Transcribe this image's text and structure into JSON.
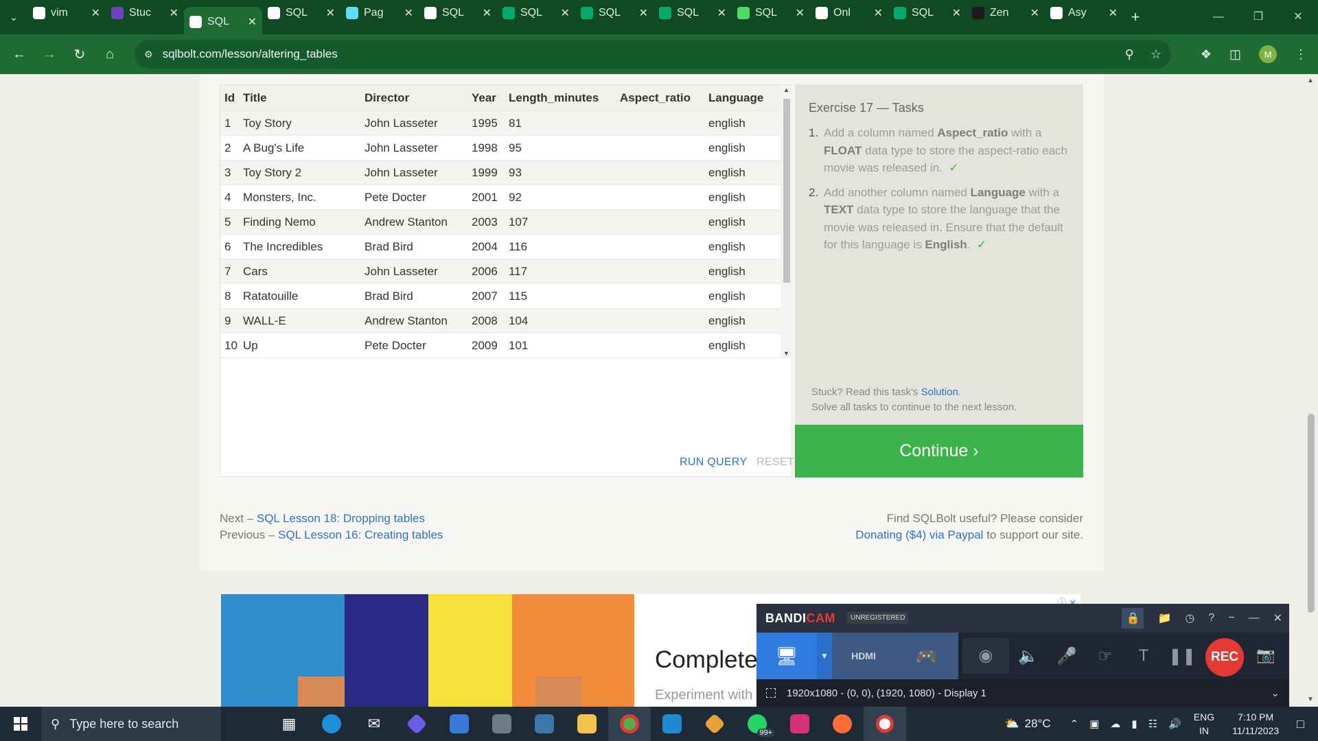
{
  "browser": {
    "tabs": [
      {
        "label": "vim",
        "fav": "github-icon",
        "color": "#ffffff"
      },
      {
        "label": "Stuc",
        "fav": "study-icon",
        "color": "#6f42c1"
      },
      {
        "label": "SQL",
        "fav": "database-icon",
        "color": "#ffffff",
        "active": true
      },
      {
        "label": "SQL",
        "fav": "database-icon",
        "color": "#ffffff"
      },
      {
        "label": "Pag",
        "fav": "react-icon",
        "color": "#61dafb"
      },
      {
        "label": "SQL",
        "fav": "leaf-icon",
        "color": "#ffffff"
      },
      {
        "label": "SQL",
        "fav": "w3-icon",
        "color": "#04aa6d"
      },
      {
        "label": "SQL",
        "fav": "w3-icon",
        "color": "#04aa6d"
      },
      {
        "label": "SQL",
        "fav": "w3-icon",
        "color": "#04aa6d"
      },
      {
        "label": "SQL",
        "fav": "spinner-icon",
        "color": "#4cd964"
      },
      {
        "label": "Onl",
        "fav": "leaf-icon",
        "color": "#ffffff"
      },
      {
        "label": "SQL",
        "fav": "w3-icon",
        "color": "#04aa6d"
      },
      {
        "label": "Zen",
        "fav": "zen-icon",
        "color": "#1b1b1b"
      },
      {
        "label": "Asy",
        "fav": "medium-icon",
        "color": "#ffffff"
      }
    ],
    "url": "sqlbolt.com/lesson/altering_tables",
    "profile_initial": "M",
    "theme_color": "#1e6b34"
  },
  "table": {
    "columns": [
      "Id",
      "Title",
      "Director",
      "Year",
      "Length_minutes",
      "Aspect_ratio",
      "Language"
    ],
    "rows": [
      [
        "1",
        "Toy Story",
        "John Lasseter",
        "1995",
        "81",
        "",
        "english"
      ],
      [
        "2",
        "A Bug's Life",
        "John Lasseter",
        "1998",
        "95",
        "",
        "english"
      ],
      [
        "3",
        "Toy Story 2",
        "John Lasseter",
        "1999",
        "93",
        "",
        "english"
      ],
      [
        "4",
        "Monsters, Inc.",
        "Pete Docter",
        "2001",
        "92",
        "",
        "english"
      ],
      [
        "5",
        "Finding Nemo",
        "Andrew Stanton",
        "2003",
        "107",
        "",
        "english"
      ],
      [
        "6",
        "The Incredibles",
        "Brad Bird",
        "2004",
        "116",
        "",
        "english"
      ],
      [
        "7",
        "Cars",
        "John Lasseter",
        "2006",
        "117",
        "",
        "english"
      ],
      [
        "8",
        "Ratatouille",
        "Brad Bird",
        "2007",
        "115",
        "",
        "english"
      ],
      [
        "9",
        "WALL-E",
        "Andrew Stanton",
        "2008",
        "104",
        "",
        "english"
      ],
      [
        "10",
        "Up",
        "Pete Docter",
        "2009",
        "101",
        "",
        "english"
      ]
    ]
  },
  "editor": {
    "run_label": "RUN QUERY",
    "reset_label": "RESET"
  },
  "tasks": {
    "title": "Exercise 17 — Tasks",
    "items": [
      {
        "num": "1.",
        "t1": "Add a column named ",
        "b1": "Aspect_ratio",
        "t2": " with a ",
        "b2": "FLOAT",
        "t3": " data type to store the aspect-ratio each movie was released in.",
        "check": "✓"
      },
      {
        "num": "2.",
        "t1": "Add another column named ",
        "b1": "Language",
        "t2": " with a ",
        "b2": "TEXT",
        "t3": " data type to store the language that the movie was released in. Ensure that the default for this language is ",
        "b3": "English",
        "t4": ".",
        "check": "✓"
      }
    ],
    "stuck_text": "Stuck? Read this task's ",
    "solution_link": "Solution",
    "stuck_end": ".",
    "solve_all": "Solve all tasks to continue to the next lesson.",
    "continue_label": "Continue ›"
  },
  "footer": {
    "next_prefix": "Next – ",
    "next_link": "SQL Lesson 18: Dropping tables",
    "prev_prefix": "Previous – ",
    "prev_link": "SQL Lesson 16: Creating tables",
    "useful": "Find SQLBolt useful? Please consider",
    "donate_link": "Donating ($4) via Paypal",
    "donate_suffix": " to support our site."
  },
  "ad": {
    "headline": "Complete",
    "sub": "Experiment with"
  },
  "bandicam": {
    "logo_a": "BANDI",
    "logo_b": "CAM",
    "unregistered": "UNREGISTERED",
    "rec_label": "REC",
    "hdmi_label": "HDMI",
    "status": "1920x1080 - (0, 0), (1920, 1080) - Display 1"
  },
  "taskbar": {
    "search_placeholder": "Type here to search",
    "whatsapp_badge": "99+",
    "temperature": "28°C",
    "lang_top": "ENG",
    "lang_bottom": "IN",
    "time": "7:10 PM",
    "date": "11/11/2023"
  }
}
